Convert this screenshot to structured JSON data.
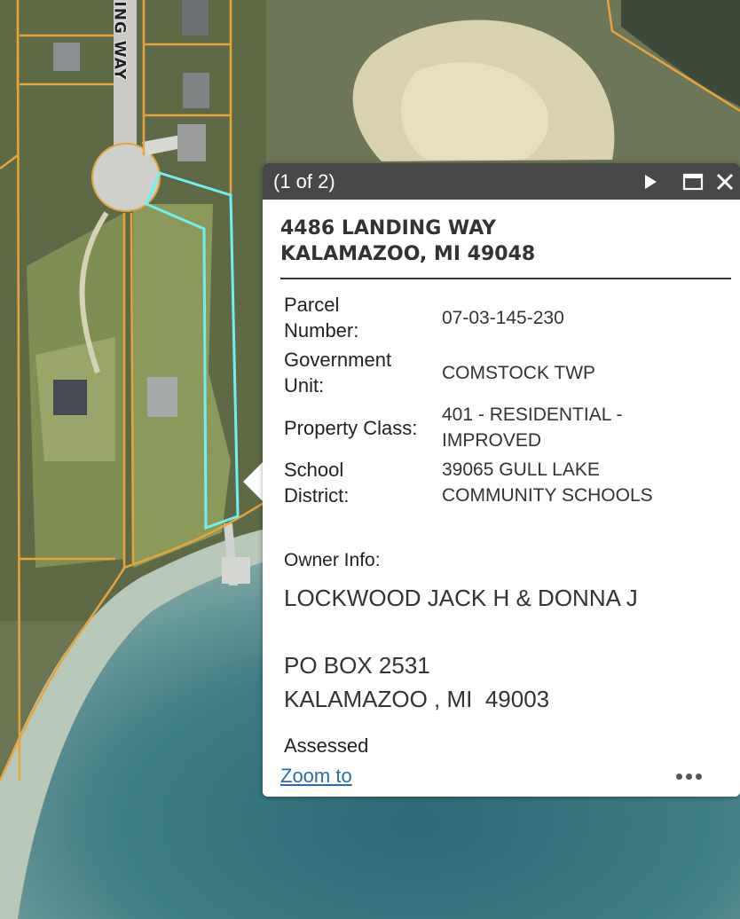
{
  "map": {
    "street_label": "ING WAY",
    "colors": {
      "parcel_line": "#e8a43b",
      "selected_parcel": "#6ff0f0",
      "water": "#4a8590",
      "shore": "#b6c9bd",
      "sand": "#e2d9b7"
    }
  },
  "popup": {
    "count": "(1 of 2)",
    "next_icon": "play-triangle-icon",
    "maximize_icon": "maximize-icon",
    "close_icon": "close-icon",
    "address_line1": "4486 LANDING WAY",
    "address_line2": "KALAMAZOO, MI 49048",
    "attributes": [
      {
        "label": "Parcel Number:",
        "value": "07-03-145-230"
      },
      {
        "label": "Government Unit:",
        "value": "COMSTOCK TWP"
      },
      {
        "label": "Property Class:",
        "value": "401 - RESIDENTIAL - IMPROVED"
      },
      {
        "label": "School District:",
        "value": "39065 GULL LAKE COMMUNITY SCHOOLS"
      }
    ],
    "owner_label": "Owner Info:",
    "owner_name": "LOCKWOOD JACK H & DONNA J",
    "owner_address1": "PO BOX 2531",
    "owner_address2": "KALAMAZOO , MI  49003",
    "cut_label": "Assessed",
    "zoom_to": "Zoom to",
    "more_icon": "more-options-icon"
  }
}
